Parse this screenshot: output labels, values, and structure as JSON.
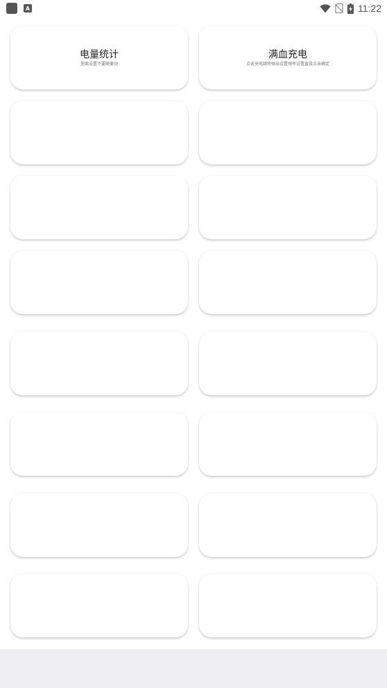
{
  "status_bar": {
    "time": "11:22",
    "left_icons": [
      "app-icon",
      "a-icon"
    ],
    "right_icons": [
      "wifi-icon",
      "no-sim-icon",
      "battery-charging-icon"
    ]
  },
  "cards": [
    {
      "title": "电量统计",
      "subtitle": "里面设置不要随便动"
    },
    {
      "title": "满血充电",
      "subtitle": "点击充电跳转弹出设置频率设置直接点击确定"
    },
    {
      "title": "",
      "subtitle": ""
    },
    {
      "title": "",
      "subtitle": ""
    },
    {
      "title": "",
      "subtitle": ""
    },
    {
      "title": "",
      "subtitle": ""
    },
    {
      "title": "",
      "subtitle": ""
    },
    {
      "title": "",
      "subtitle": ""
    },
    {
      "title": "",
      "subtitle": ""
    },
    {
      "title": "",
      "subtitle": ""
    },
    {
      "title": "",
      "subtitle": ""
    },
    {
      "title": "",
      "subtitle": ""
    },
    {
      "title": "",
      "subtitle": ""
    },
    {
      "title": "",
      "subtitle": ""
    },
    {
      "title": "",
      "subtitle": ""
    },
    {
      "title": "",
      "subtitle": ""
    }
  ]
}
